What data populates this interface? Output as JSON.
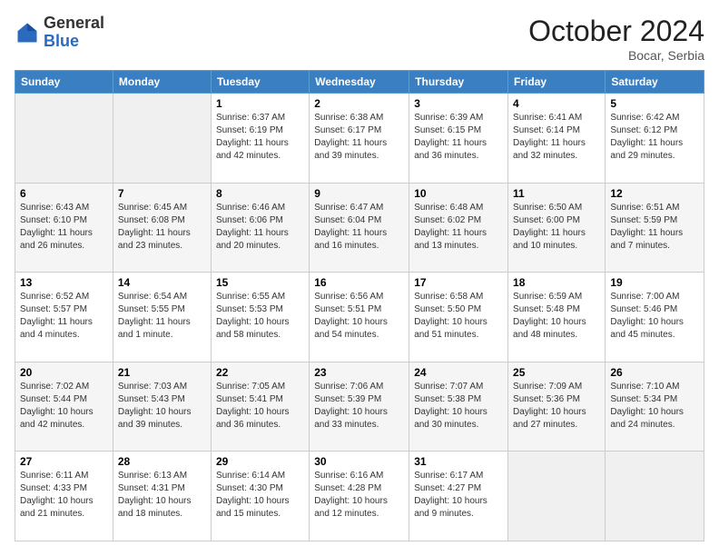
{
  "header": {
    "logo_general": "General",
    "logo_blue": "Blue",
    "month_title": "October 2024",
    "location": "Bocar, Serbia"
  },
  "days_of_week": [
    "Sunday",
    "Monday",
    "Tuesday",
    "Wednesday",
    "Thursday",
    "Friday",
    "Saturday"
  ],
  "weeks": [
    [
      null,
      null,
      {
        "day": "1",
        "sunrise": "6:37 AM",
        "sunset": "6:19 PM",
        "daylight": "11 hours and 42 minutes."
      },
      {
        "day": "2",
        "sunrise": "6:38 AM",
        "sunset": "6:17 PM",
        "daylight": "11 hours and 39 minutes."
      },
      {
        "day": "3",
        "sunrise": "6:39 AM",
        "sunset": "6:15 PM",
        "daylight": "11 hours and 36 minutes."
      },
      {
        "day": "4",
        "sunrise": "6:41 AM",
        "sunset": "6:14 PM",
        "daylight": "11 hours and 32 minutes."
      },
      {
        "day": "5",
        "sunrise": "6:42 AM",
        "sunset": "6:12 PM",
        "daylight": "11 hours and 29 minutes."
      }
    ],
    [
      {
        "day": "6",
        "sunrise": "6:43 AM",
        "sunset": "6:10 PM",
        "daylight": "11 hours and 26 minutes."
      },
      {
        "day": "7",
        "sunrise": "6:45 AM",
        "sunset": "6:08 PM",
        "daylight": "11 hours and 23 minutes."
      },
      {
        "day": "8",
        "sunrise": "6:46 AM",
        "sunset": "6:06 PM",
        "daylight": "11 hours and 20 minutes."
      },
      {
        "day": "9",
        "sunrise": "6:47 AM",
        "sunset": "6:04 PM",
        "daylight": "11 hours and 16 minutes."
      },
      {
        "day": "10",
        "sunrise": "6:48 AM",
        "sunset": "6:02 PM",
        "daylight": "11 hours and 13 minutes."
      },
      {
        "day": "11",
        "sunrise": "6:50 AM",
        "sunset": "6:00 PM",
        "daylight": "11 hours and 10 minutes."
      },
      {
        "day": "12",
        "sunrise": "6:51 AM",
        "sunset": "5:59 PM",
        "daylight": "11 hours and 7 minutes."
      }
    ],
    [
      {
        "day": "13",
        "sunrise": "6:52 AM",
        "sunset": "5:57 PM",
        "daylight": "11 hours and 4 minutes."
      },
      {
        "day": "14",
        "sunrise": "6:54 AM",
        "sunset": "5:55 PM",
        "daylight": "11 hours and 1 minute."
      },
      {
        "day": "15",
        "sunrise": "6:55 AM",
        "sunset": "5:53 PM",
        "daylight": "10 hours and 58 minutes."
      },
      {
        "day": "16",
        "sunrise": "6:56 AM",
        "sunset": "5:51 PM",
        "daylight": "10 hours and 54 minutes."
      },
      {
        "day": "17",
        "sunrise": "6:58 AM",
        "sunset": "5:50 PM",
        "daylight": "10 hours and 51 minutes."
      },
      {
        "day": "18",
        "sunrise": "6:59 AM",
        "sunset": "5:48 PM",
        "daylight": "10 hours and 48 minutes."
      },
      {
        "day": "19",
        "sunrise": "7:00 AM",
        "sunset": "5:46 PM",
        "daylight": "10 hours and 45 minutes."
      }
    ],
    [
      {
        "day": "20",
        "sunrise": "7:02 AM",
        "sunset": "5:44 PM",
        "daylight": "10 hours and 42 minutes."
      },
      {
        "day": "21",
        "sunrise": "7:03 AM",
        "sunset": "5:43 PM",
        "daylight": "10 hours and 39 minutes."
      },
      {
        "day": "22",
        "sunrise": "7:05 AM",
        "sunset": "5:41 PM",
        "daylight": "10 hours and 36 minutes."
      },
      {
        "day": "23",
        "sunrise": "7:06 AM",
        "sunset": "5:39 PM",
        "daylight": "10 hours and 33 minutes."
      },
      {
        "day": "24",
        "sunrise": "7:07 AM",
        "sunset": "5:38 PM",
        "daylight": "10 hours and 30 minutes."
      },
      {
        "day": "25",
        "sunrise": "7:09 AM",
        "sunset": "5:36 PM",
        "daylight": "10 hours and 27 minutes."
      },
      {
        "day": "26",
        "sunrise": "7:10 AM",
        "sunset": "5:34 PM",
        "daylight": "10 hours and 24 minutes."
      }
    ],
    [
      {
        "day": "27",
        "sunrise": "6:11 AM",
        "sunset": "4:33 PM",
        "daylight": "10 hours and 21 minutes."
      },
      {
        "day": "28",
        "sunrise": "6:13 AM",
        "sunset": "4:31 PM",
        "daylight": "10 hours and 18 minutes."
      },
      {
        "day": "29",
        "sunrise": "6:14 AM",
        "sunset": "4:30 PM",
        "daylight": "10 hours and 15 minutes."
      },
      {
        "day": "30",
        "sunrise": "6:16 AM",
        "sunset": "4:28 PM",
        "daylight": "10 hours and 12 minutes."
      },
      {
        "day": "31",
        "sunrise": "6:17 AM",
        "sunset": "4:27 PM",
        "daylight": "10 hours and 9 minutes."
      },
      null,
      null
    ]
  ]
}
